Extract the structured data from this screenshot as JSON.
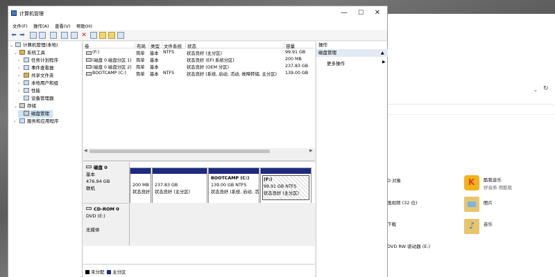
{
  "window": {
    "title": "计算机管理",
    "minimize": "—",
    "maximize": "☐",
    "close": "✕"
  },
  "menu": [
    "文件(F)",
    "操作(A)",
    "查看(V)",
    "帮助(H)"
  ],
  "tree": {
    "root": "计算机管理(本地)",
    "system_tools": "系统工具",
    "items": [
      "任务计划程序",
      "事件查看器",
      "共享文件夹",
      "本地用户和组",
      "性能",
      "设备管理器"
    ],
    "storage": "存储",
    "disk_mgmt": "磁盘管理",
    "services": "服务和应用程序"
  },
  "volume_list": {
    "headers": [
      "卷",
      "布局",
      "类型",
      "文件系统",
      "状态",
      "容量"
    ],
    "rows": [
      [
        "(F:)",
        "简单",
        "基本",
        "NTFS",
        "状态良好 (主分区)",
        "99.91 GB"
      ],
      [
        "(磁盘 0 磁盘分区 1)",
        "简单",
        "基本",
        "",
        "状态良好 (EFI 系统分区)",
        "200 MB"
      ],
      [
        "(磁盘 0 磁盘分区 2)",
        "简单",
        "基本",
        "",
        "状态良好 (OEM 分区)",
        "237.83 GB"
      ],
      [
        "BOOTCAMP (C:)",
        "简单",
        "基本",
        "NTFS",
        "状态良好 (系统, 启动, 活动, 故障转储, 主分区)",
        "139.00 GB"
      ]
    ]
  },
  "disks": {
    "disk0": {
      "name": "磁盘 0",
      "type": "基本",
      "size": "476.94 GB",
      "status": "联机"
    },
    "parts": [
      {
        "name": "",
        "size": "200 MB",
        "status": "状态良好"
      },
      {
        "name": "",
        "size": "237.83 GB",
        "status": "状态良好 (主分区)"
      },
      {
        "name": "BOOTCAMP  (C:)",
        "size": "139.00 GB NTFS",
        "status": "状态良好 (系统, 启动, 活"
      },
      {
        "name": "(F:)",
        "size": "99.91 GB NTFS",
        "status": "状态良好 (主分区)"
      }
    ],
    "cdrom": {
      "name": "CD-ROM 0",
      "type": "DVD (E:)",
      "status": "无媒体"
    }
  },
  "legend": {
    "unallocated": "未分配",
    "primary": "主分区"
  },
  "legend_colors": {
    "unallocated": "#000000",
    "primary": "#1c2a80"
  },
  "actions": {
    "header": "操作",
    "section": "磁盘管理",
    "more": "更多操作"
  },
  "background_explorer": {
    "items": [
      {
        "label": "酷我音乐",
        "sub": "好音质 用酷我"
      },
      {
        "label": "图片"
      },
      {
        "label": "音乐"
      }
    ],
    "left_items": [
      "D 对象",
      "画视频 (32 位)",
      "下载",
      "DVD RW 驱动器 (E:)"
    ]
  }
}
